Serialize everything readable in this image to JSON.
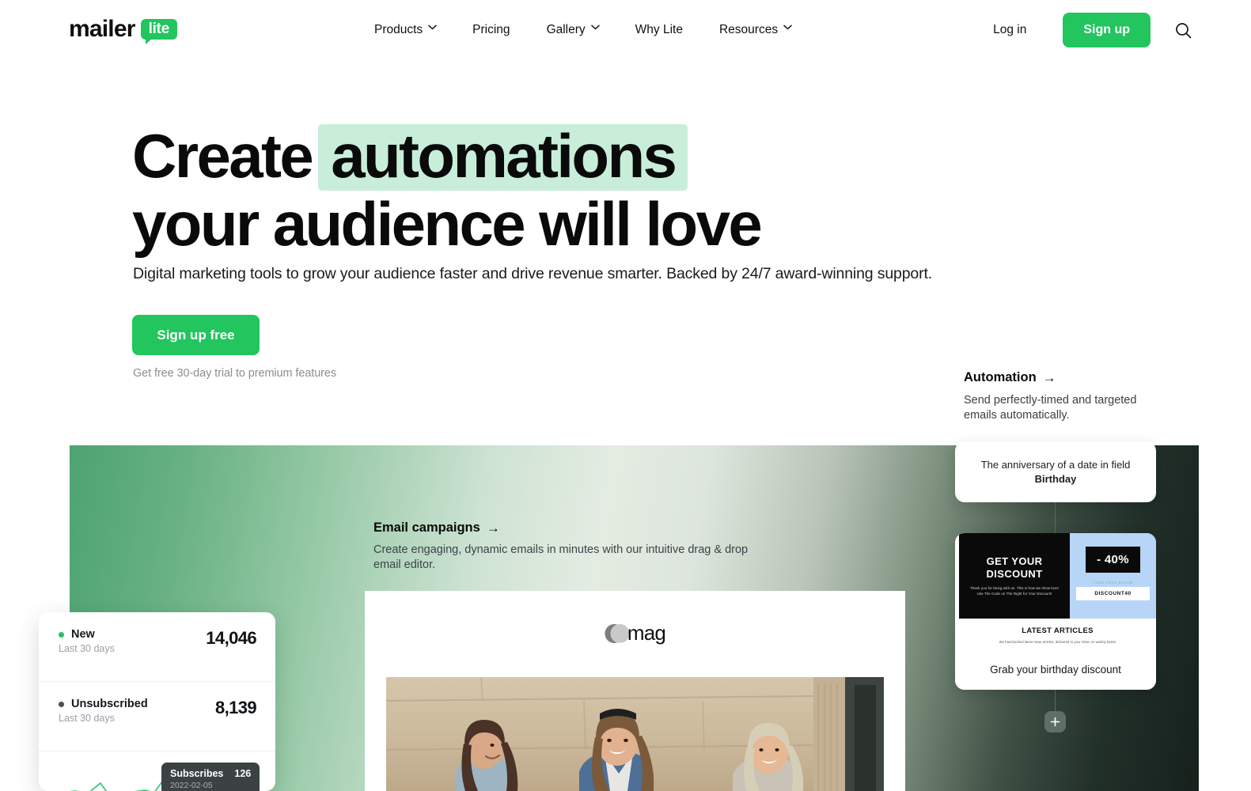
{
  "header": {
    "logo": {
      "primary": "mailer",
      "badge": "lite"
    },
    "nav": [
      {
        "label": "Products",
        "has_chevron": true,
        "icon": "chevron-down-icon"
      },
      {
        "label": "Pricing",
        "has_chevron": false
      },
      {
        "label": "Gallery",
        "has_chevron": true,
        "icon": "chevron-down-icon"
      },
      {
        "label": "Why Lite",
        "has_chevron": false
      },
      {
        "label": "Resources",
        "has_chevron": true,
        "icon": "chevron-down-icon"
      }
    ],
    "login_label": "Log in",
    "signup_label": "Sign up",
    "search_icon": "search-icon"
  },
  "hero": {
    "headline_part1": "Create",
    "headline_highlight": "automations",
    "headline_line2": "your audience will love",
    "highlight_color": "#c8eed9",
    "subheadline": "Digital marketing tools to grow your audience faster and drive revenue smarter. Backed by 24/7 award-winning support.",
    "cta_label": "Sign up free",
    "cta_color": "#22c55e",
    "cta_note": "Get free 30-day trial to premium features"
  },
  "email_campaigns": {
    "title": "Email campaigns",
    "arrow": "→",
    "description": "Create engaging, dynamic emails in minutes with our intuitive drag & drop email editor."
  },
  "automation": {
    "title": "Automation",
    "arrow": "→",
    "description": "Send perfectly-timed and targeted emails automatically.",
    "trigger_card": {
      "text_before": "The anniversary of a date in field ",
      "field_name": "Birthday"
    },
    "email_card": {
      "headline": "GET YOUR DISCOUNT",
      "body": "Thank you for being with us. This is how we show love! Use The Code on The Right for Your Discount!",
      "discount_badge": "- 40%",
      "code_label": "YOUR CODE BELOW",
      "code_value": "DISCOUNT40",
      "articles_heading": "LATEST ARTICLES",
      "articles_sub": "We hand-picked latest news articles, delivered to your inbox on weekly basis!",
      "step_label": "Grab your birthday discount"
    },
    "add_step_icon": "plus-icon"
  },
  "email_preview": {
    "brand": "mag",
    "brand_icon": "eclipse-circles-icon",
    "photo_alt": "three women smiling in front of a sandstone wall"
  },
  "stats_card": {
    "rows": [
      {
        "name": "New",
        "period": "Last 30 days",
        "value": "14,046",
        "dot_color": "#22c55e"
      },
      {
        "name": "Unsubscribed",
        "period": "Last 30 days",
        "value": "8,139",
        "dot_color": "#4b5156"
      }
    ],
    "tooltip": {
      "label": "Subscribes",
      "value": "126",
      "date": "2022-02-05"
    }
  }
}
